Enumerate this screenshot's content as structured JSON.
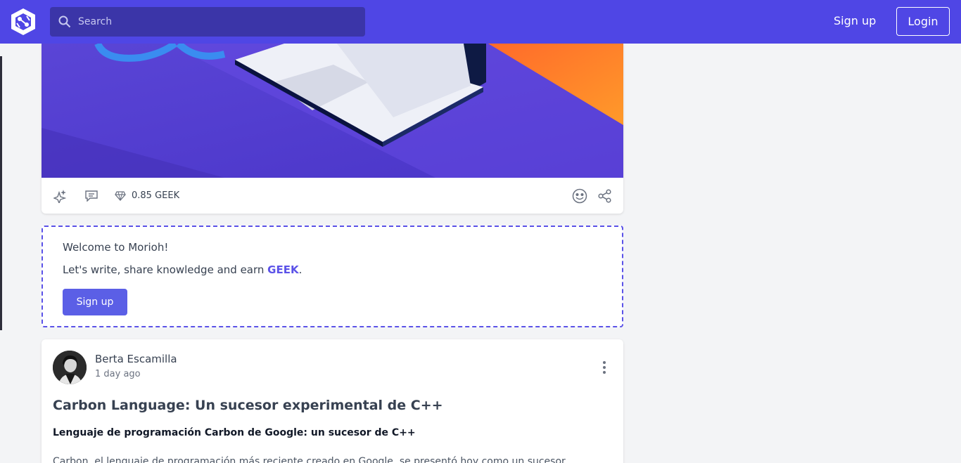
{
  "header": {
    "search_placeholder": "Search",
    "signup_label": "Sign up",
    "login_label": "Login"
  },
  "card": {
    "geek_value": "0.85 GEEK"
  },
  "welcome": {
    "title": "Welcome to Morioh!",
    "text_prefix": "Let's write, share knowledge and earn ",
    "text_highlight": "GEEK",
    "text_suffix": ".",
    "signup_label": "Sign up"
  },
  "post": {
    "author": "Berta Escamilla",
    "time": "1 day ago",
    "title": "Carbon Language: Un sucesor experimental de C++",
    "subtitle": "Lenguaje de programación Carbon de Google: un sucesor de C++",
    "body": "Carbon, el lenguaje de programación más reciente creado en Google, se presentó hoy como un sucesor"
  },
  "colors": {
    "brand": "#4f46e5",
    "accent": "#5b52e8"
  }
}
